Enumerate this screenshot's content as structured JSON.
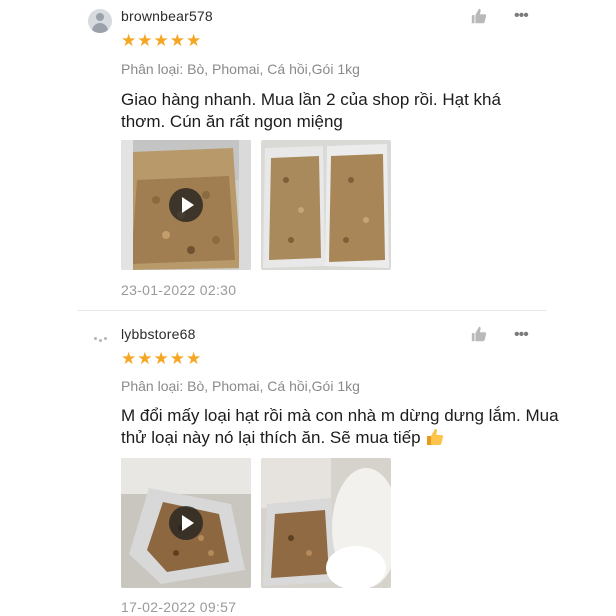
{
  "reviews": [
    {
      "username": "brownbear578",
      "rating": 5,
      "variant": "Phân loại: Bò, Phomai, Cá hồi,Gói 1kg",
      "content": "Giao hàng nhanh. Mua lần 2 của shop rồi. Hạt khá thơm. Cún ăn rất ngon miệng",
      "date": "23-01-2022 02:30",
      "media": [
        {
          "type": "video",
          "desc": "kibble-bag-video"
        },
        {
          "type": "image",
          "desc": "kibble-bags-photo"
        }
      ]
    },
    {
      "username": "lybbstore68",
      "rating": 5,
      "variant": "Phân loại: Bò, Phomai, Cá hồi,Gói 1kg",
      "content": "M đổi mấy loại hạt rồi mà con nhà m dừng dưng lắm. Mua thử loại này nó lại thích ăn. Sẽ mua tiếp",
      "emoji": "thumbs-up",
      "date": "17-02-2022 09:57",
      "media": [
        {
          "type": "video",
          "desc": "kibble-bag-video"
        },
        {
          "type": "image",
          "desc": "dog-and-bag-photo"
        }
      ]
    }
  ],
  "icons": {
    "like": "thumbs-up-icon",
    "more": "more-icon",
    "play": "play-icon"
  },
  "colors": {
    "star": "#f5a623",
    "text": "#1c1c1c",
    "muted": "#8a8a8a"
  }
}
